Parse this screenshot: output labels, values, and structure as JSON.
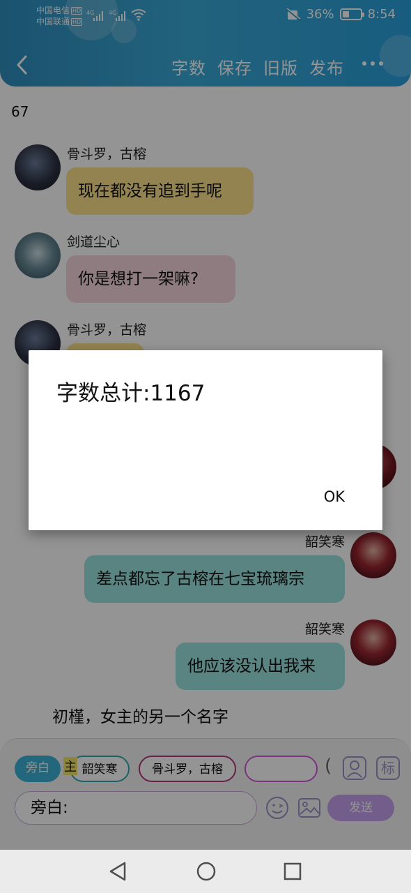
{
  "status_bar": {
    "carrier1": "中国电信",
    "carrier2": "中国联通",
    "hd": "HD",
    "net1": "4G",
    "net2": "4G",
    "battery_pct": "36%",
    "battery_level": 0.36,
    "time": "8:54"
  },
  "header": {
    "actions": [
      "字数",
      "保存",
      "旧版",
      "发布"
    ]
  },
  "chat": {
    "count_line": "67",
    "messages": [
      {
        "name": "骨斗罗，古榕",
        "text": "现在都没有追到手呢"
      },
      {
        "name": "剑道尘心",
        "text": "你是想打一架嘛?"
      },
      {
        "name": "骨斗罗，古榕",
        "text": ""
      },
      {
        "name": "韶笑寒",
        "text": "差点都忘了古榕在七宝琉璃宗"
      },
      {
        "name": "韶笑寒",
        "text": "他应该没认出我来"
      }
    ],
    "narration": "初槿，女主的另一个名字"
  },
  "compose": {
    "chips": [
      "旁白",
      "韶笑寒",
      "骨斗罗，古榕",
      "",
      "("
    ],
    "tag_char": "主",
    "mark_icon_text": "标",
    "input_value": "旁白:",
    "send_label": "发送"
  },
  "dialog": {
    "message": "字数总计:1167",
    "ok_label": "OK"
  },
  "colors": {
    "header": "#3aa9d6",
    "bubble_yellow": "#fbe28a",
    "bubble_pink": "#f7d6df",
    "bubble_teal": "#9be3df",
    "send": "#c4a1f0"
  }
}
